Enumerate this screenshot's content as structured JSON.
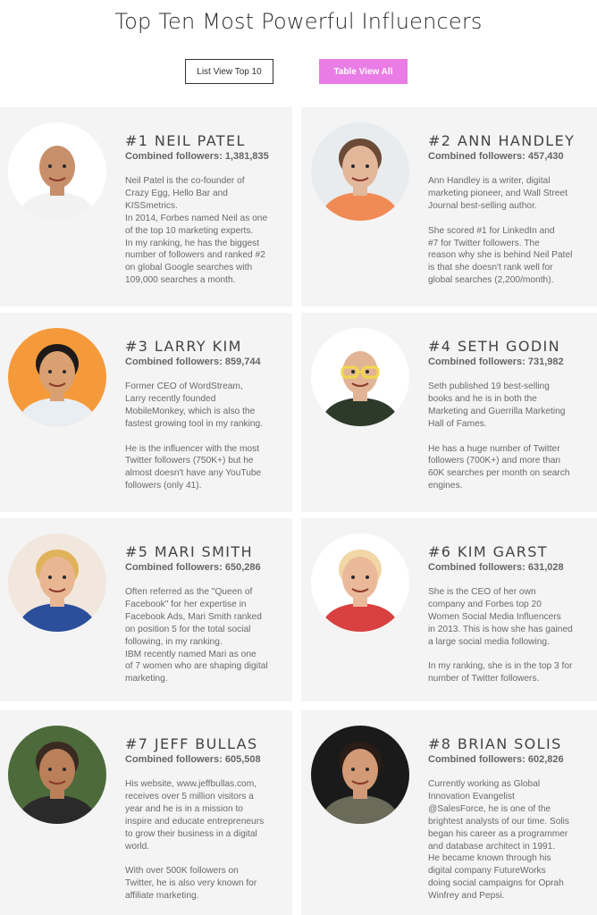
{
  "page": {
    "title": "Top Ten Most Powerful Influencers"
  },
  "buttons": {
    "list_view": "List View Top 10",
    "table_view": "Table View All"
  },
  "colors": {
    "accent": "#ea7ce6",
    "card_bg": "#f4f4f4"
  },
  "influencers": [
    {
      "name": "#1 NEIL PATEL",
      "followers": "Combined followers: 1,381,835",
      "avatar_icon": "neil-patel-photo",
      "bio": [
        "Neil Patel is the co-founder of",
        "Crazy Egg, Hello Bar and",
        "KISSmetrics.",
        "In 2014, Forbes named Neil as one",
        "of the top 10 marketing experts.",
        "In my ranking, he has the biggest",
        "number of followers and ranked #2",
        "on global Google searches with",
        "109,000 searches a month."
      ]
    },
    {
      "name": "#2 ANN HANDLEY",
      "followers": "Combined followers: 457,430",
      "avatar_icon": "ann-handley-photo",
      "bio": [
        "Ann Handley is a writer, digital",
        "marketing pioneer, and Wall Street",
        "Journal best-selling author.",
        "",
        "She scored #1 for LinkedIn  and",
        "#7 for Twitter followers. The",
        "reason why she is behind Neil Patel",
        "is that she doesn't rank well for",
        "global searches (2,200/month)."
      ]
    },
    {
      "name": "#3 LARRY KIM",
      "followers": "Combined followers: 859,744",
      "avatar_icon": "larry-kim-photo",
      "bio": [
        "Former CEO of WordStream,",
        "Larry recently founded",
        "MobileMonkey, which is also the",
        "fastest growing tool in my ranking.",
        "",
        "He is the influencer with the most",
        "Twitter followers (750K+) but he",
        "almost doesn't have any YouTube",
        "followers (only 41)."
      ]
    },
    {
      "name": "#4 SETH GODIN",
      "followers": "Combined followers: 731,982",
      "avatar_icon": "seth-godin-photo",
      "bio": [
        "Seth published 19 best-selling",
        "books and he is in both the",
        "Marketing and Guerrilla Marketing",
        "Hall of Fames.",
        "",
        "He has a huge number of Twitter",
        "followers (700K+) and more than",
        "60K searches per month on search",
        "engines."
      ]
    },
    {
      "name": "#5 MARI SMITH",
      "followers": "Combined followers: 650,286",
      "avatar_icon": "mari-smith-photo",
      "bio": [
        "Often referred as the \"Queen of",
        "Facebook\" for her expertise in",
        "Facebook Ads, Mari Smith ranked",
        "on position 5 for the total social",
        "following, in my ranking.",
        "IBM recently named Mari as one",
        "of 7 women who are shaping digital",
        "marketing."
      ]
    },
    {
      "name": "#6 KIM GARST",
      "followers": "Combined followers: 631,028",
      "avatar_icon": "kim-garst-photo",
      "bio": [
        "She is the CEO of her own",
        "company and Forbes top 20",
        "Women Social Media Influencers",
        "in 2013. This is how she has gained",
        "a large social media following.",
        "",
        "In my ranking, she is in the top 3 for",
        "number of Twitter followers."
      ]
    },
    {
      "name": "#7 JEFF BULLAS",
      "followers": "Combined followers: 605,508",
      "avatar_icon": "jeff-bullas-photo",
      "bio": [
        "His website, www.jeffbullas.com,",
        "receives over 5 million visitors a",
        "year and he is in a mission to",
        "inspire and educate entrepreneurs",
        "to grow their business in a digital",
        "world.",
        "",
        "With over 500K followers on",
        "Twitter, he is also very known for",
        "affiliate marketing."
      ]
    },
    {
      "name": "#8 BRIAN SOLIS",
      "followers": "Combined followers: 602,826",
      "avatar_icon": "brian-solis-photo",
      "bio": [
        "Currently working as Global",
        "Innovation Evangelist",
        "@SalesForce, he is one of the",
        "brightest analysts of our time. Solis",
        "began his career as a programmer",
        "and database architect in 1991.",
        "He became known through his",
        "digital company FutureWorks",
        "doing social campaigns for Oprah",
        "Winfrey and Pepsi."
      ]
    }
  ]
}
